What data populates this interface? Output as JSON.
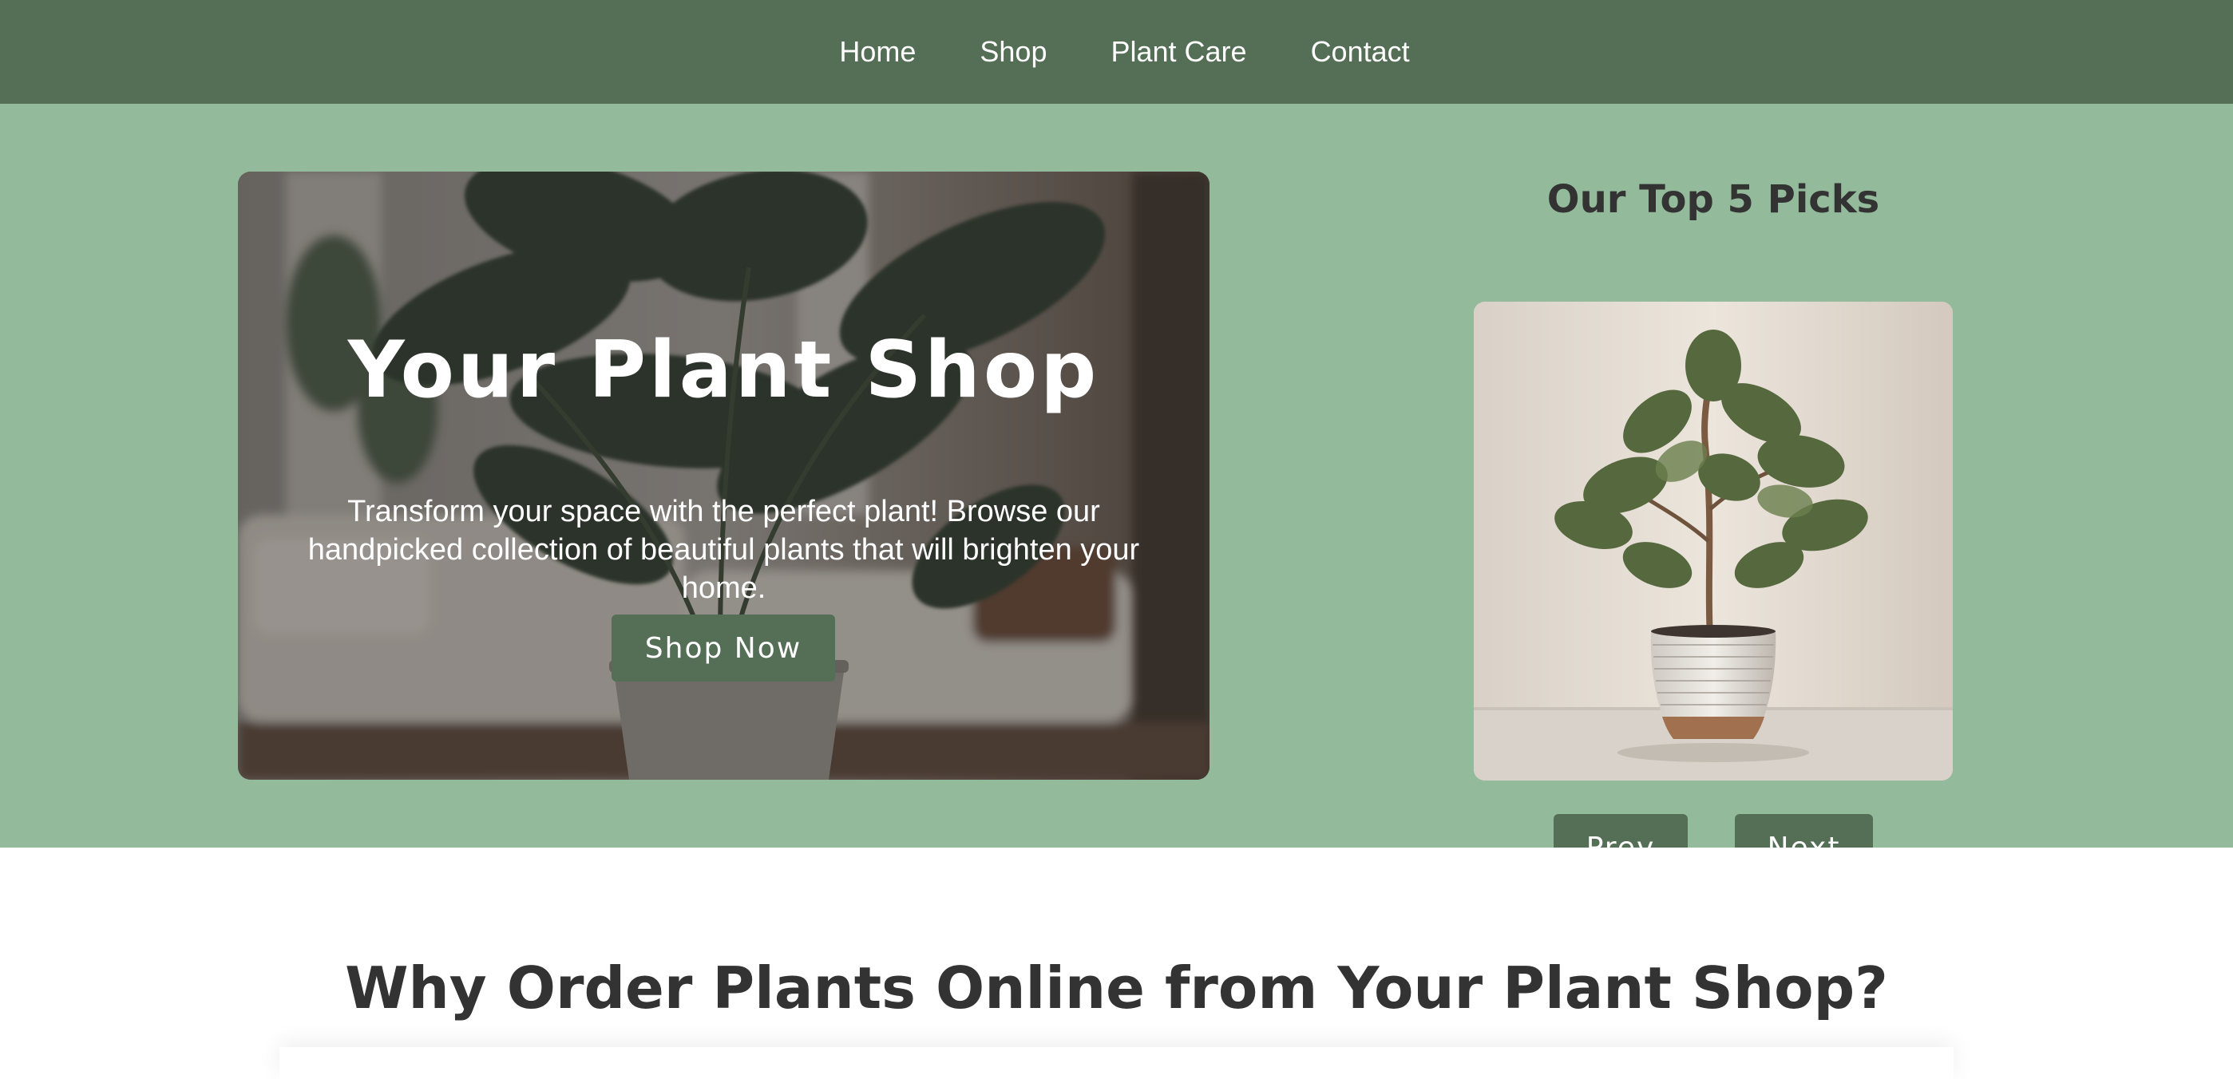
{
  "nav": {
    "items": [
      {
        "label": "Home"
      },
      {
        "label": "Shop"
      },
      {
        "label": "Plant Care"
      },
      {
        "label": "Contact"
      }
    ]
  },
  "hero": {
    "title": "Your Plant Shop",
    "description": "Transform your space with the perfect plant! Browse our handpicked collection of beautiful plants that will brighten your home.",
    "cta_label": "Shop Now"
  },
  "picks": {
    "title": "Our Top 5 Picks",
    "prev_label": "Prev",
    "next_label": "Next"
  },
  "why": {
    "title": "Why Order Plants Online from Your Plant Shop?"
  },
  "colors": {
    "nav_bg": "#556f57",
    "hero_bg": "#93bb9b",
    "button_bg": "#556f57",
    "heading_text": "#333333"
  }
}
